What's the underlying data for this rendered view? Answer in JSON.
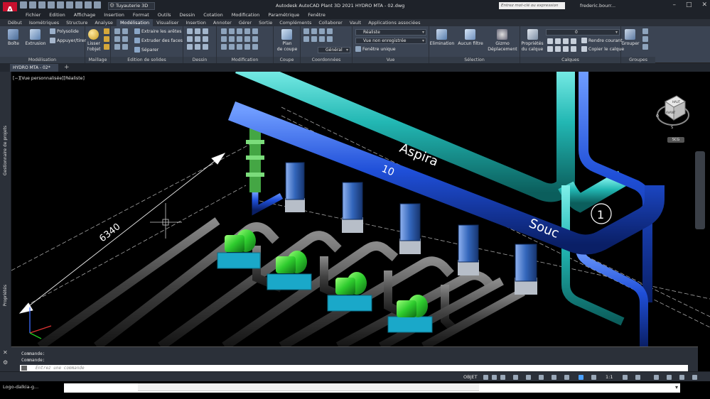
{
  "app": {
    "logo": "A",
    "workspace": "Tuyauterie 3D",
    "window_title": "Autodesk AutoCAD Plant 3D 2021   HYDRO MTA - 02.dwg",
    "search_placeholder": "Entrez mot-clé ou expression",
    "user": "frederic.bourr...",
    "accent": "#c8102e"
  },
  "menu": [
    "Fichier",
    "Edition",
    "Affichage",
    "Insertion",
    "Format",
    "Outils",
    "Dessin",
    "Cotation",
    "Modification",
    "Paramétrique",
    "Fenêtre"
  ],
  "ribbon_tabs": [
    "Début",
    "Isométriques",
    "Structure",
    "Analyse",
    "Modélisation",
    "Visualiser",
    "Insertion",
    "Annoter",
    "Gérer",
    "Sortie",
    "Compléments",
    "Collaborer",
    "Vault",
    "Applications associées"
  ],
  "active_tab": "Modélisation",
  "ribbon": {
    "modelisation": {
      "boite": "Boîte",
      "extrusion": "Extrusion",
      "polysolide": "Polysolide",
      "appuyer_tirer": "Appuyer/tirer",
      "title": "Modélisation"
    },
    "maillage": {
      "lisser_1": "Lisser",
      "lisser_2": "l'objet",
      "title": "Maillage"
    },
    "edition_solides": {
      "extraire": "Extraire les arêtes",
      "extruder": "Extruder des faces",
      "separer": "Séparer",
      "title": "Edition de solides"
    },
    "dessin": {
      "title": "Dessin"
    },
    "modification": {
      "title": "Modification"
    },
    "coupe": {
      "plan_1": "Plan",
      "plan_2": "de coupe",
      "title": "Coupe"
    },
    "coordonnees": {
      "general": "Général",
      "title": "Coordonnées"
    },
    "vue": {
      "style": "Réaliste",
      "vue_nommee": "Vue non enregistrée",
      "fenetre": "Fenêtre unique",
      "title": "Vue"
    },
    "selection": {
      "elimination": "Elimination",
      "aucun_filtre_1": "Aucun filtre",
      "gizmo_1": "Gizmo",
      "gizmo_2": "Déplacement",
      "title": "Sélection"
    },
    "calques": {
      "proprietes_1": "Propriétés",
      "proprietes_2": "du calque",
      "calque_courant": "0",
      "rendre_courant": "Rendre courant",
      "copier_calque": "Copier le calque",
      "title": "Calques"
    },
    "groupes": {
      "grouper": "Grouper",
      "title": "Groupes"
    }
  },
  "document": {
    "tab": "HYDRO MTA - 02*",
    "add": "+"
  },
  "palette": {
    "gestionnaire": "Gestionnaire de projets",
    "proprietes": "Propriétés"
  },
  "viewport": {
    "label": "[−][Vue personnalisée][Réaliste]",
    "dimension": "6340",
    "text_aspiration": "Aspira",
    "text_souc": "Souc",
    "text_1": "1",
    "text_10": "10",
    "viewcube_top": "HAUT",
    "viewcube_front": "AVANT",
    "compass_o": "O",
    "compass_s": "S",
    "scu": "SCG"
  },
  "command": {
    "line1": "Commande:",
    "line2": "Commande:",
    "placeholder": "Entrez une commande"
  },
  "status": {
    "model": "OBJET",
    "scale": "1:1"
  },
  "taskbar": {
    "label": "Logo-dalkia-g..."
  },
  "colors": {
    "pipe_cyan": "#1fb5b5",
    "pipe_blue": "#1f4fd8",
    "pipe_grey": "#3a3a3a",
    "pump_green": "#2ecc2e",
    "exchanger_blue": "#3366bb"
  }
}
